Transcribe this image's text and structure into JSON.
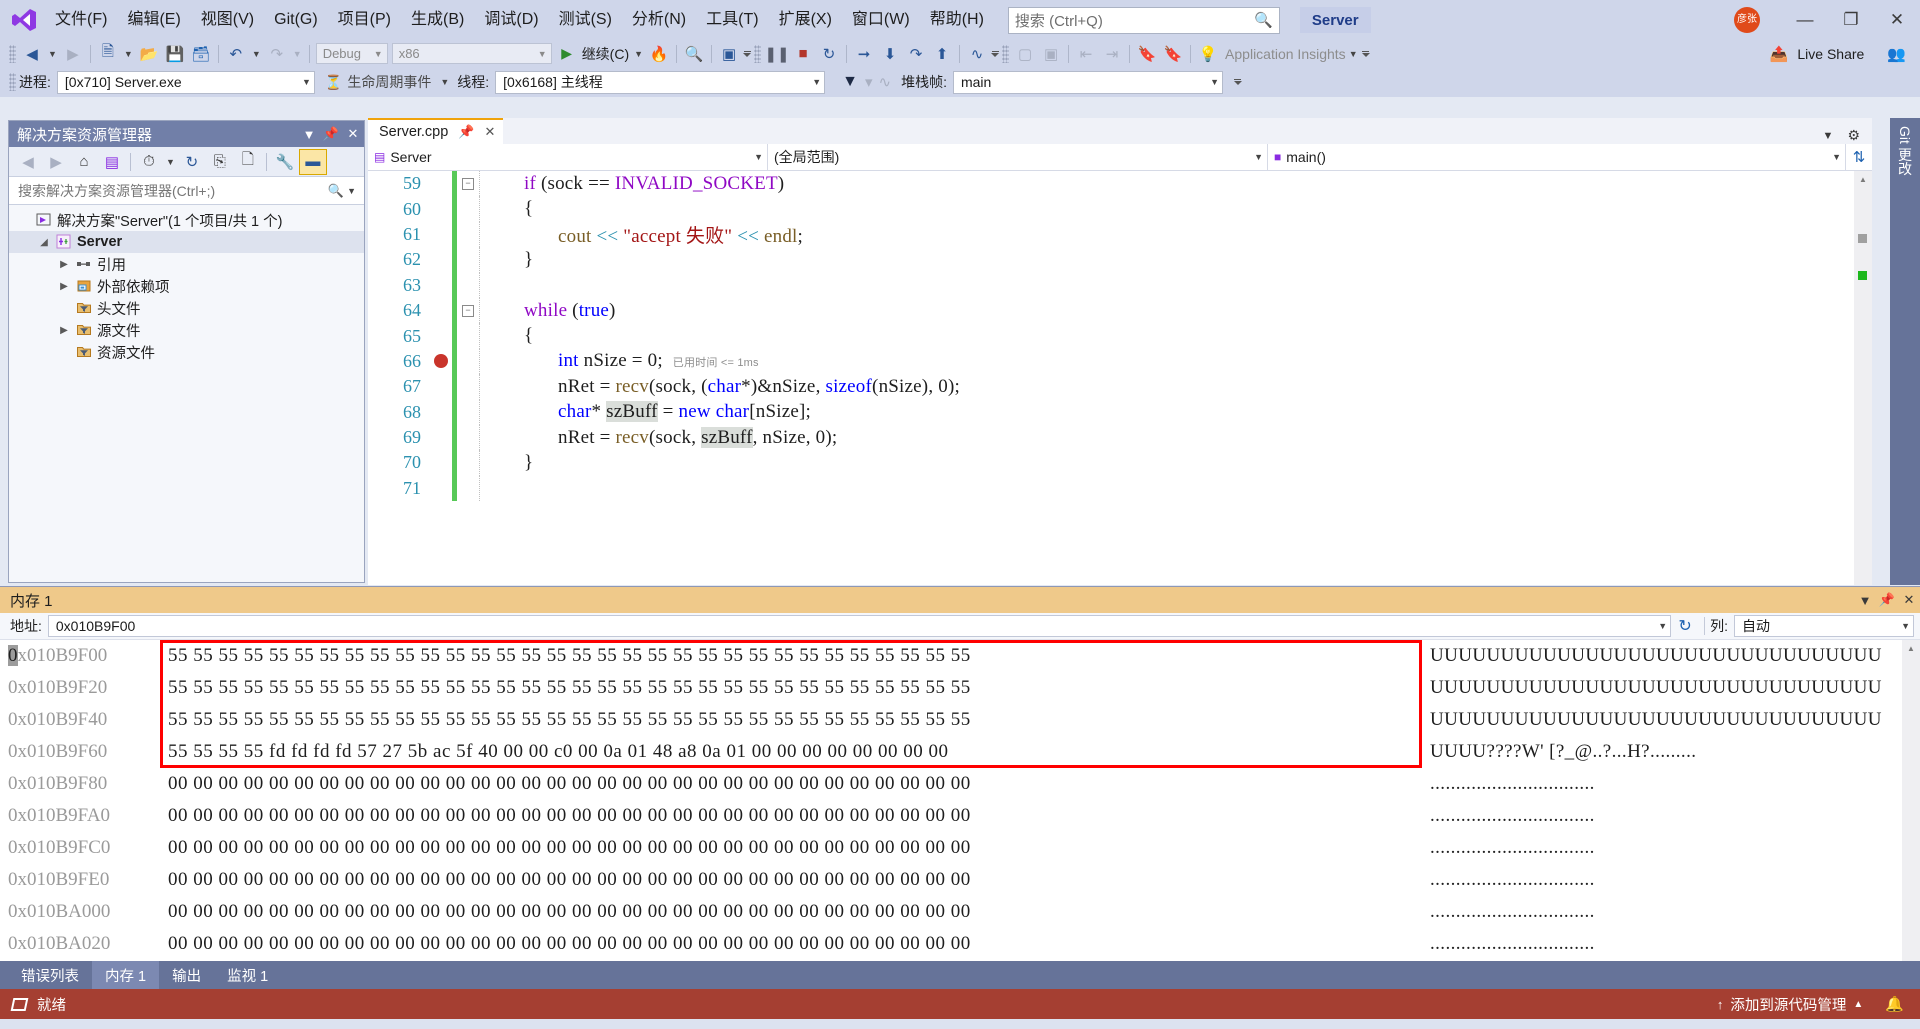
{
  "app": {
    "logo_icon": "vs-logo-icon",
    "server_chip": "Server",
    "avatar_text": "彦张",
    "window_buttons": {
      "minimize": "—",
      "restore": "❐",
      "close": "✕"
    }
  },
  "menu": {
    "items": [
      {
        "label": "文件(F)"
      },
      {
        "label": "编辑(E)"
      },
      {
        "label": "视图(V)"
      },
      {
        "label": "Git(G)"
      },
      {
        "label": "项目(P)"
      },
      {
        "label": "生成(B)"
      },
      {
        "label": "调试(D)"
      },
      {
        "label": "测试(S)"
      },
      {
        "label": "分析(N)"
      },
      {
        "label": "工具(T)"
      },
      {
        "label": "扩展(X)"
      },
      {
        "label": "窗口(W)"
      },
      {
        "label": "帮助(H)"
      }
    ]
  },
  "search": {
    "placeholder": "搜索 (Ctrl+Q)",
    "icon": "search-icon"
  },
  "toolbar": {
    "config_combo": "Debug",
    "platform_combo": "x86",
    "continue_label": "继续(C)",
    "app_insights_label": "Application Insights",
    "live_share_label": "Live Share"
  },
  "debugbar": {
    "process_label": "进程:",
    "process_value": "[0x710] Server.exe",
    "lifecycle_label": "生命周期事件",
    "thread_label": "线程:",
    "thread_value": "[0x6168] 主线程",
    "stackframe_label": "堆栈帧:",
    "stackframe_value": "main"
  },
  "solution_explorer": {
    "title": "解决方案资源管理器",
    "search_placeholder": "搜索解决方案资源管理器(Ctrl+;)",
    "toolbar_icons": [
      "back-icon",
      "forward-icon",
      "home-icon",
      "switch-views-icon",
      "pending-changes-icon",
      "refresh-icon",
      "collapse-all-icon",
      "show-all-files-icon",
      "properties-icon",
      "preview-selected-icon"
    ],
    "tree": [
      {
        "label": "解决方案\"Server\"(1 个项目/共 1 个)",
        "icon": "solution-icon",
        "indent": 0,
        "twisty": "",
        "bold": false,
        "selected": false
      },
      {
        "label": "Server",
        "icon": "cpp-project-icon",
        "indent": 1,
        "twisty": "▲",
        "bold": true,
        "selected": true
      },
      {
        "label": "引用",
        "icon": "references-icon",
        "indent": 2,
        "twisty": "▶",
        "bold": false,
        "selected": false
      },
      {
        "label": "外部依赖项",
        "icon": "external-deps-icon",
        "indent": 2,
        "twisty": "▶",
        "bold": false,
        "selected": false
      },
      {
        "label": "头文件",
        "icon": "filter-folder-icon",
        "indent": 2,
        "twisty": "",
        "bold": false,
        "selected": false
      },
      {
        "label": "源文件",
        "icon": "filter-folder-icon",
        "indent": 2,
        "twisty": "▶",
        "bold": false,
        "selected": false
      },
      {
        "label": "资源文件",
        "icon": "filter-folder-icon",
        "indent": 2,
        "twisty": "",
        "bold": false,
        "selected": false
      }
    ]
  },
  "editor": {
    "tab_label": "Server.cpp",
    "nav_project": "Server",
    "nav_scope": "(全局范围)",
    "nav_member": "main()",
    "tooltip": "已用时间 <= 1ms",
    "lines": [
      {
        "num": "59",
        "fold": "−",
        "breakpoint": false
      },
      {
        "num": "60",
        "fold": "",
        "breakpoint": false
      },
      {
        "num": "61",
        "fold": "",
        "breakpoint": false
      },
      {
        "num": "62",
        "fold": "",
        "breakpoint": false
      },
      {
        "num": "63",
        "fold": "",
        "breakpoint": false
      },
      {
        "num": "64",
        "fold": "−",
        "breakpoint": false
      },
      {
        "num": "65",
        "fold": "",
        "breakpoint": false
      },
      {
        "num": "66",
        "fold": "",
        "breakpoint": true
      },
      {
        "num": "67",
        "fold": "",
        "breakpoint": false
      },
      {
        "num": "68",
        "fold": "",
        "breakpoint": false
      },
      {
        "num": "69",
        "fold": "",
        "breakpoint": false
      },
      {
        "num": "70",
        "fold": "",
        "breakpoint": false
      },
      {
        "num": "71",
        "fold": "",
        "breakpoint": false
      }
    ],
    "code": [
      "    if (sock == INVALID_SOCKET)",
      "    {",
      "        cout << \"accept 失败\" << endl;",
      "    }",
      "",
      "    while (true)",
      "    {",
      "        int nSize = 0;",
      "        nRet = recv(sock, (char*)&nSize, sizeof(nSize), 0);",
      "        char* szBuff = new char[nSize];",
      "        nRet = recv(sock, szBuff, nSize, 0);",
      "    }",
      ""
    ]
  },
  "git_panel": {
    "label": "Git 更改"
  },
  "memory": {
    "title": "内存 1",
    "address_label": "地址:",
    "address_value": "0x010B9F00",
    "columns_label": "列:",
    "columns_value": "自动",
    "refresh_icon": "refresh-icon",
    "rows": [
      {
        "address": "0x010B9F00",
        "hex": "55 55 55 55 55 55 55 55 55 55 55 55 55 55 55 55 55 55 55 55 55 55 55 55 55 55 55 55 55 55 55 55",
        "ascii": "UUUUUUUUUUUUUUUUUUUUUUUUUUUUUUUU",
        "highlighted": true
      },
      {
        "address": "0x010B9F20",
        "hex": "55 55 55 55 55 55 55 55 55 55 55 55 55 55 55 55 55 55 55 55 55 55 55 55 55 55 55 55 55 55 55 55",
        "ascii": "UUUUUUUUUUUUUUUUUUUUUUUUUUUUUUUU",
        "highlighted": true
      },
      {
        "address": "0x010B9F40",
        "hex": "55 55 55 55 55 55 55 55 55 55 55 55 55 55 55 55 55 55 55 55 55 55 55 55 55 55 55 55 55 55 55 55",
        "ascii": "UUUUUUUUUUUUUUUUUUUUUUUUUUUUUUUU",
        "highlighted": true
      },
      {
        "address": "0x010B9F60",
        "hex": "55 55 55 55 fd fd fd fd 57 27 5b ac 5f 40 00 00 c0 00 0a 01 48 a8 0a 01 00 00 00 00 00 00 00 00",
        "ascii": "UUUU????W' [?_@..?...H?.........",
        "highlighted": true
      },
      {
        "address": "0x010B9F80",
        "hex": "00 00 00 00 00 00 00 00 00 00 00 00 00 00 00 00 00 00 00 00 00 00 00 00 00 00 00 00 00 00 00 00",
        "ascii": "................................",
        "highlighted": false
      },
      {
        "address": "0x010B9FA0",
        "hex": "00 00 00 00 00 00 00 00 00 00 00 00 00 00 00 00 00 00 00 00 00 00 00 00 00 00 00 00 00 00 00 00",
        "ascii": "................................",
        "highlighted": false
      },
      {
        "address": "0x010B9FC0",
        "hex": "00 00 00 00 00 00 00 00 00 00 00 00 00 00 00 00 00 00 00 00 00 00 00 00 00 00 00 00 00 00 00 00",
        "ascii": "................................",
        "highlighted": false
      },
      {
        "address": "0x010B9FE0",
        "hex": "00 00 00 00 00 00 00 00 00 00 00 00 00 00 00 00 00 00 00 00 00 00 00 00 00 00 00 00 00 00 00 00",
        "ascii": "................................",
        "highlighted": false
      },
      {
        "address": "0x010BA000",
        "hex": "00 00 00 00 00 00 00 00 00 00 00 00 00 00 00 00 00 00 00 00 00 00 00 00 00 00 00 00 00 00 00 00",
        "ascii": "................................",
        "highlighted": false
      },
      {
        "address": "0x010BA020",
        "hex": "00 00 00 00 00 00 00 00 00 00 00 00 00 00 00 00 00 00 00 00 00 00 00 00 00 00 00 00 00 00 00 00",
        "ascii": "................................",
        "highlighted": false
      }
    ]
  },
  "bottom_tabs": [
    {
      "label": "错误列表",
      "active": false
    },
    {
      "label": "内存 1",
      "active": true
    },
    {
      "label": "输出",
      "active": false
    },
    {
      "label": "监视 1",
      "active": false
    }
  ],
  "statusbar": {
    "ready_label": "就绪",
    "source_control_label": "添加到源代码管理",
    "bell_icon": "bell-icon"
  },
  "colors": {
    "accent_blue": "#CFD6EA",
    "panel_header": "#717FA8",
    "memory_header": "#EFC98A",
    "status_bar": "#A53F32",
    "highlight_box": "#FF0000",
    "tab_active_border": "#F0A30A",
    "change_bar_green": "#57C957",
    "breakpoint_red": "#C9342B"
  }
}
